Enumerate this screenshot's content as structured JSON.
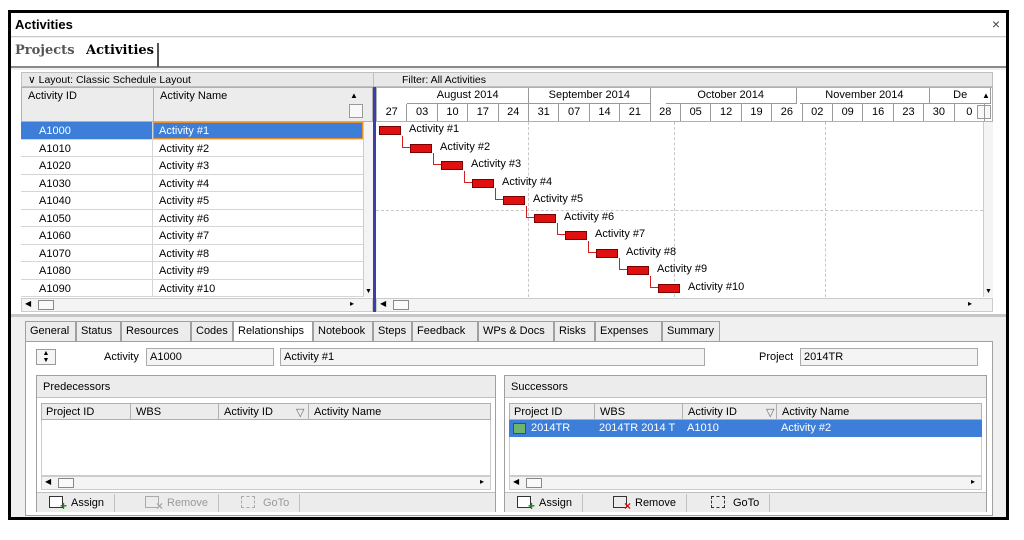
{
  "window": {
    "title": "Activities",
    "close_glyph": "×"
  },
  "top_tabs": [
    "Projects",
    "Activities"
  ],
  "layout_label": "Layout: Classic Schedule Layout",
  "filter_label": "Filter: All Activities",
  "grid": {
    "columns": [
      "Activity ID",
      "Activity Name"
    ],
    "rows": [
      {
        "id": "A1000",
        "name": "Activity #1"
      },
      {
        "id": "A1010",
        "name": "Activity #2"
      },
      {
        "id": "A1020",
        "name": "Activity #3"
      },
      {
        "id": "A1030",
        "name": "Activity #4"
      },
      {
        "id": "A1040",
        "name": "Activity #5"
      },
      {
        "id": "A1050",
        "name": "Activity #6"
      },
      {
        "id": "A1060",
        "name": "Activity #7"
      },
      {
        "id": "A1070",
        "name": "Activity #8"
      },
      {
        "id": "A1080",
        "name": "Activity #9"
      },
      {
        "id": "A1090",
        "name": "Activity #10"
      }
    ],
    "selected_index": 0
  },
  "gantt": {
    "months": [
      "August 2014",
      "September 2014",
      "October 2014",
      "November 2014",
      "De"
    ],
    "days": [
      "27",
      "03",
      "10",
      "17",
      "24",
      "31",
      "07",
      "14",
      "21",
      "28",
      "05",
      "12",
      "19",
      "26",
      "02",
      "09",
      "16",
      "23",
      "30",
      "0"
    ],
    "bar_color": "#e01010",
    "bar_labels": [
      "Activity #1",
      "Activity #2",
      "Activity #3",
      "Activity #4",
      "Activity #5",
      "Activity #6",
      "Activity #7",
      "Activity #8",
      "Activity #9",
      "Activity #10"
    ]
  },
  "detail_tabs": [
    "General",
    "Status",
    "Resources",
    "Codes",
    "Relationships",
    "Notebook",
    "Steps",
    "Feedback",
    "WPs & Docs",
    "Risks",
    "Expenses",
    "Summary"
  ],
  "active_detail_tab": "Relationships",
  "detail": {
    "activity_label": "Activity",
    "activity_id": "A1000",
    "activity_name": "Activity #1",
    "project_label": "Project",
    "project_id": "2014TR"
  },
  "predecessors": {
    "title": "Predecessors",
    "columns": [
      "Project ID",
      "WBS",
      "Activity ID",
      "Activity Name"
    ],
    "buttons": [
      "Assign",
      "Remove",
      "GoTo"
    ]
  },
  "successors": {
    "title": "Successors",
    "columns": [
      "Project ID",
      "WBS",
      "Activity ID",
      "Activity Name"
    ],
    "rows": [
      {
        "project_id": "2014TR",
        "wbs": "2014TR 2014 T",
        "activity_id": "A1010",
        "activity_name": "Activity #2"
      }
    ],
    "buttons": [
      "Assign",
      "Remove",
      "GoTo"
    ]
  },
  "sort_glyph": "▽",
  "selection_color": "#3d7ed8"
}
